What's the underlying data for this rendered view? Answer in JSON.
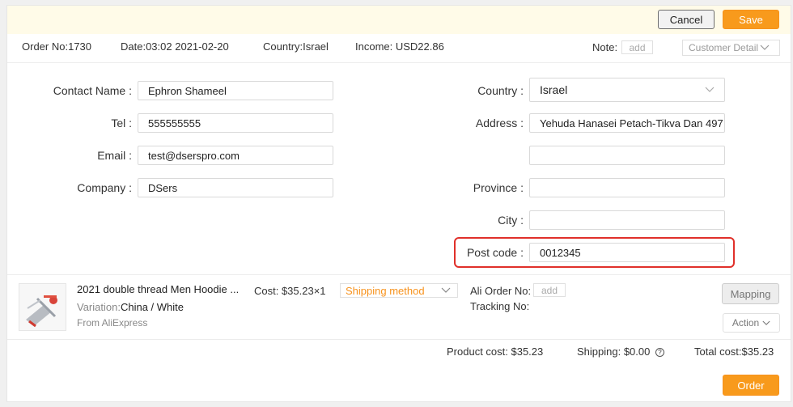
{
  "toolbar": {
    "cancel_label": "Cancel",
    "save_label": "Save"
  },
  "order_info": {
    "order_no": "Order No:1730",
    "date": "Date:03:02 2021-02-20",
    "country": "Country:Israel",
    "income": "Income: USD22.86",
    "note_label": "Note:",
    "note_add": "add",
    "customer_detail": "Customer Detail"
  },
  "form": {
    "contact_name": {
      "label": "Contact Name :",
      "value": "Ephron  Shameel"
    },
    "tel": {
      "label": "Tel :",
      "value": "555555555"
    },
    "email": {
      "label": "Email :",
      "value": "test@dserspro.com"
    },
    "company": {
      "label": "Company :",
      "value": "DSers"
    },
    "country": {
      "label": "Country :",
      "value": "Israel"
    },
    "address": {
      "label": "Address :",
      "value": "Yehuda Hanasei Petach-Tikva Dan 497"
    },
    "address2": {
      "value": ""
    },
    "province": {
      "label": "Province :",
      "value": ""
    },
    "city": {
      "label": "City :",
      "value": ""
    },
    "post_code": {
      "label": "Post code :",
      "value": "0012345"
    }
  },
  "product": {
    "title": "2021 double thread Men Hoodie ...",
    "variation_label": "Variation:",
    "variation_value": "China / White",
    "source": "From AliExpress",
    "cost": "Cost: $35.23×1",
    "shipping_method": "Shipping method",
    "ali_order_label": "Ali Order No:",
    "ali_order_add": "add",
    "tracking_label": "Tracking No:",
    "mapping_label": "Mapping",
    "action_label": "Action"
  },
  "totals": {
    "product_cost": "Product cost: $35.23",
    "shipping": "Shipping: $0.00",
    "total_cost": "Total cost:$35.23"
  },
  "footer": {
    "order_label": "Order"
  },
  "colors": {
    "accent": "#f89a1c",
    "highlight": "#e0302a",
    "topbar_bg": "#fffbe8"
  },
  "icons": [
    "chevron-down-icon",
    "question-circle-icon",
    "product-thumbnail"
  ]
}
